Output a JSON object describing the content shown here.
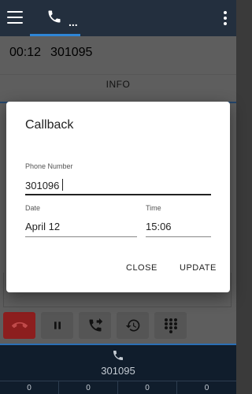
{
  "appbar": {
    "menu_icon": "hamburger-menu-icon",
    "phone_tab_icon": "phone-icon",
    "phone_tab_ellipsis": "...",
    "overflow_icon": "more-vert-icon",
    "bg_color": "#232f3e",
    "accent_color": "#2f86d6"
  },
  "call": {
    "duration": "00:12",
    "number": "301095"
  },
  "info_tab": {
    "label": "INFO"
  },
  "controls": [
    {
      "name": "hangup",
      "icon": "hangup-icon",
      "color": "#8c1e1e"
    },
    {
      "name": "hold",
      "icon": "pause-icon"
    },
    {
      "name": "transfer",
      "icon": "call-forward-icon"
    },
    {
      "name": "history",
      "icon": "history-icon"
    },
    {
      "name": "dialpad",
      "icon": "dialpad-icon"
    }
  ],
  "bottombar": {
    "icon": "phone-icon",
    "number": "301095",
    "counters": [
      "0",
      "0",
      "0",
      "0"
    ]
  },
  "dialog": {
    "title": "Callback",
    "phone_label": "Phone Number",
    "phone_value": "301096",
    "date_label": "Date",
    "date_value": "April 12",
    "time_label": "Time",
    "time_value": "15:06",
    "close_label": "CLOSE",
    "update_label": "UPDATE"
  }
}
